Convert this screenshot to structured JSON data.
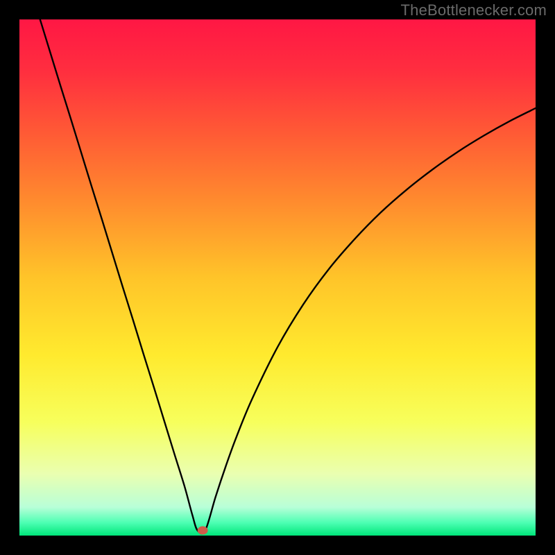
{
  "watermark": "TheBottlenecker.com",
  "chart_data": {
    "type": "line",
    "title": "",
    "xlabel": "",
    "ylabel": "",
    "xlim": [
      0,
      100
    ],
    "ylim": [
      0,
      100
    ],
    "series": [
      {
        "name": "curve",
        "x": [
          4,
          6,
          8,
          10,
          12,
          14,
          16,
          18,
          20,
          22,
          24,
          26,
          28,
          30,
          32,
          33.5,
          34.5,
          36,
          38,
          40,
          42,
          45,
          50,
          55,
          60,
          65,
          70,
          75,
          80,
          85,
          90,
          95,
          100
        ],
        "y": [
          100,
          93.5,
          87,
          80.6,
          74.1,
          67.6,
          61.2,
          54.7,
          48.2,
          41.8,
          35.3,
          28.9,
          22.4,
          15.9,
          9.5,
          4.0,
          1.0,
          1.0,
          7.5,
          13.5,
          19.0,
          26.3,
          36.5,
          44.8,
          51.7,
          57.5,
          62.6,
          67.0,
          70.9,
          74.4,
          77.5,
          80.3,
          82.8
        ]
      }
    ],
    "marker": {
      "x": 35.5,
      "y": 1.0,
      "color": "#cf5c4a"
    },
    "background": {
      "stops": [
        {
          "pct": 0,
          "color": "#ff1744"
        },
        {
          "pct": 10,
          "color": "#ff2e3f"
        },
        {
          "pct": 22,
          "color": "#ff5a35"
        },
        {
          "pct": 35,
          "color": "#ff8a2e"
        },
        {
          "pct": 50,
          "color": "#ffc429"
        },
        {
          "pct": 65,
          "color": "#ffea2e"
        },
        {
          "pct": 78,
          "color": "#f7ff5c"
        },
        {
          "pct": 88,
          "color": "#eaffb0"
        },
        {
          "pct": 94.5,
          "color": "#b8ffd8"
        },
        {
          "pct": 97.5,
          "color": "#4dffb3"
        },
        {
          "pct": 100,
          "color": "#00e67a"
        }
      ]
    }
  }
}
